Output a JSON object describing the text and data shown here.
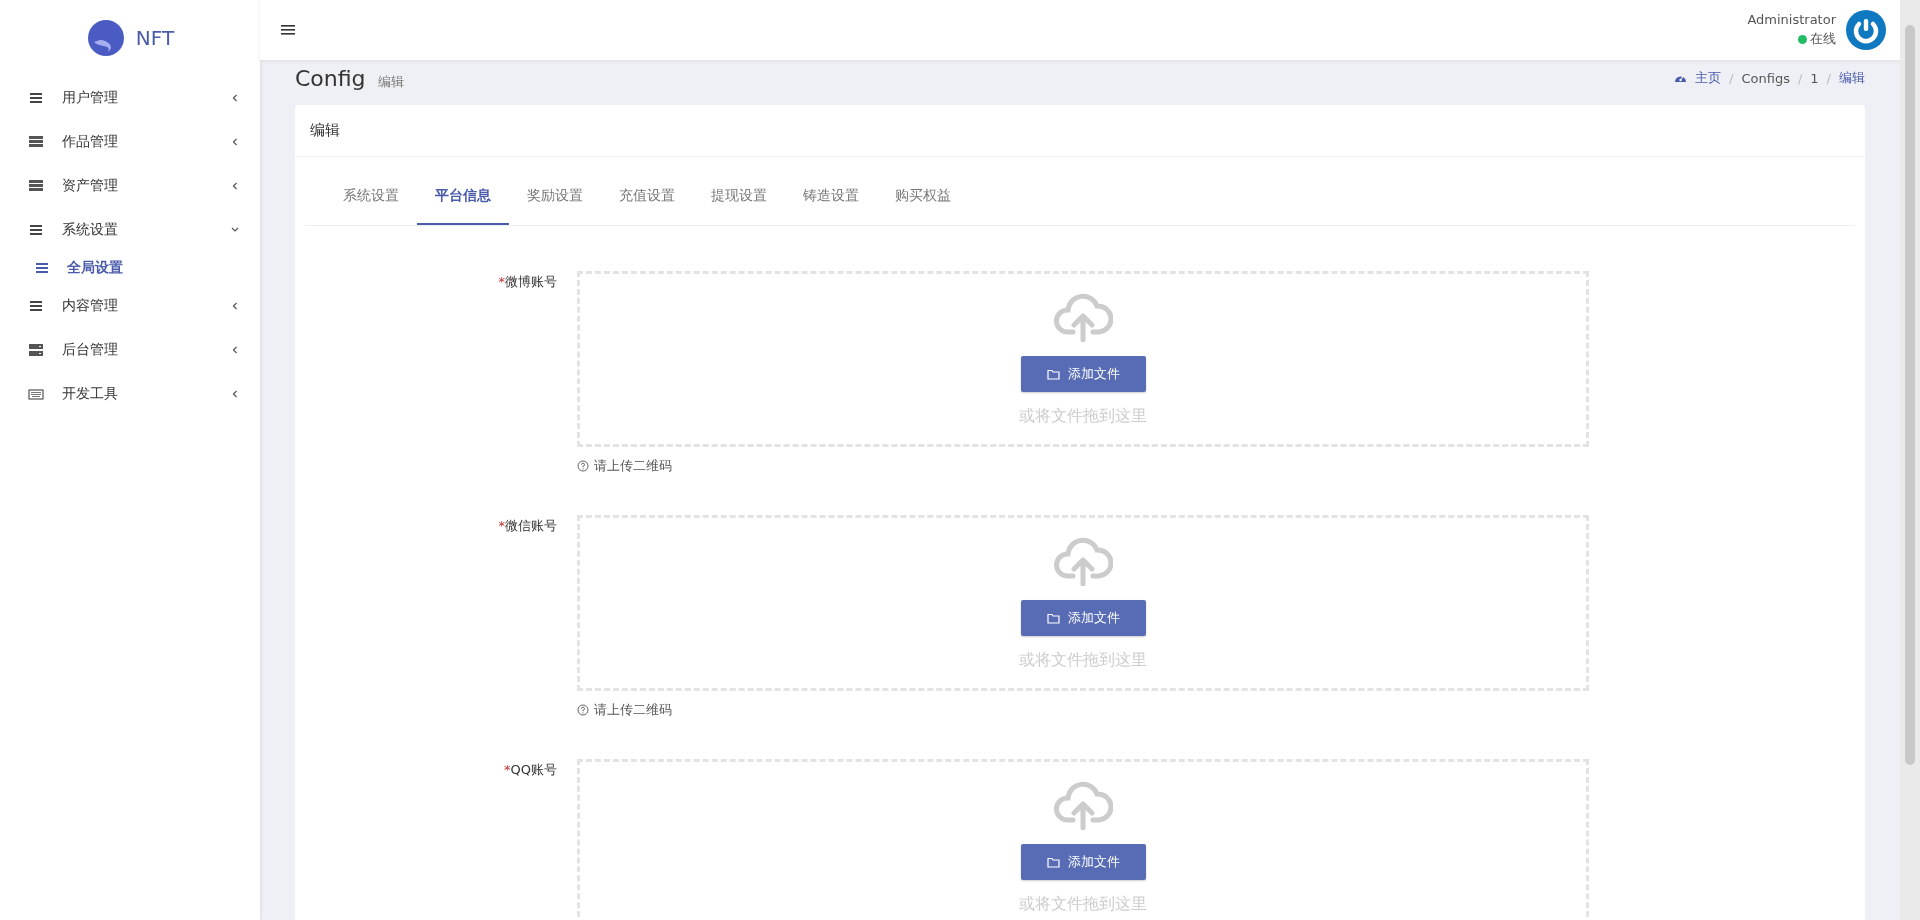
{
  "sidebar": {
    "logo_text": "NFT",
    "items": [
      {
        "label": "用户管理",
        "kind": "list",
        "expanded": false
      },
      {
        "label": "作品管理",
        "kind": "stack",
        "expanded": false
      },
      {
        "label": "资产管理",
        "kind": "stack",
        "expanded": false
      },
      {
        "label": "系统设置",
        "kind": "list",
        "expanded": true,
        "children": [
          {
            "label": "全局设置",
            "selected": true
          }
        ]
      },
      {
        "label": "内容管理",
        "kind": "list",
        "expanded": false
      },
      {
        "label": "后台管理",
        "kind": "server",
        "expanded": false
      },
      {
        "label": "开发工具",
        "kind": "keyboard",
        "expanded": false
      }
    ]
  },
  "header": {
    "user_name": "Administrator",
    "status": "在线",
    "online": true
  },
  "page": {
    "title": "Config",
    "subtitle": "编辑",
    "breadcrumb_separator": "/",
    "breadcrumb": [
      "主页",
      "Configs",
      "1",
      "编辑"
    ]
  },
  "card": {
    "title": "编辑",
    "tabs": [
      {
        "label": "系统设置",
        "selected": false
      },
      {
        "label": "平台信息",
        "selected": true
      },
      {
        "label": "奖励设置",
        "selected": false
      },
      {
        "label": "充值设置",
        "selected": false
      },
      {
        "label": "提现设置",
        "selected": false
      },
      {
        "label": "铸造设置",
        "selected": false
      },
      {
        "label": "购买权益",
        "selected": false
      }
    ],
    "fields": [
      {
        "label": "微博账号",
        "required_mark": "*",
        "button": "添加文件",
        "drop_hint": "或将文件拖到这里",
        "help": "请上传二维码"
      },
      {
        "label": "微信账号",
        "required_mark": "*",
        "button": "添加文件",
        "drop_hint": "或将文件拖到这里",
        "help": "请上传二维码"
      },
      {
        "label": "QQ账号",
        "required_mark": "*",
        "button": "添加文件",
        "drop_hint": "或将文件拖到这里"
      }
    ]
  }
}
